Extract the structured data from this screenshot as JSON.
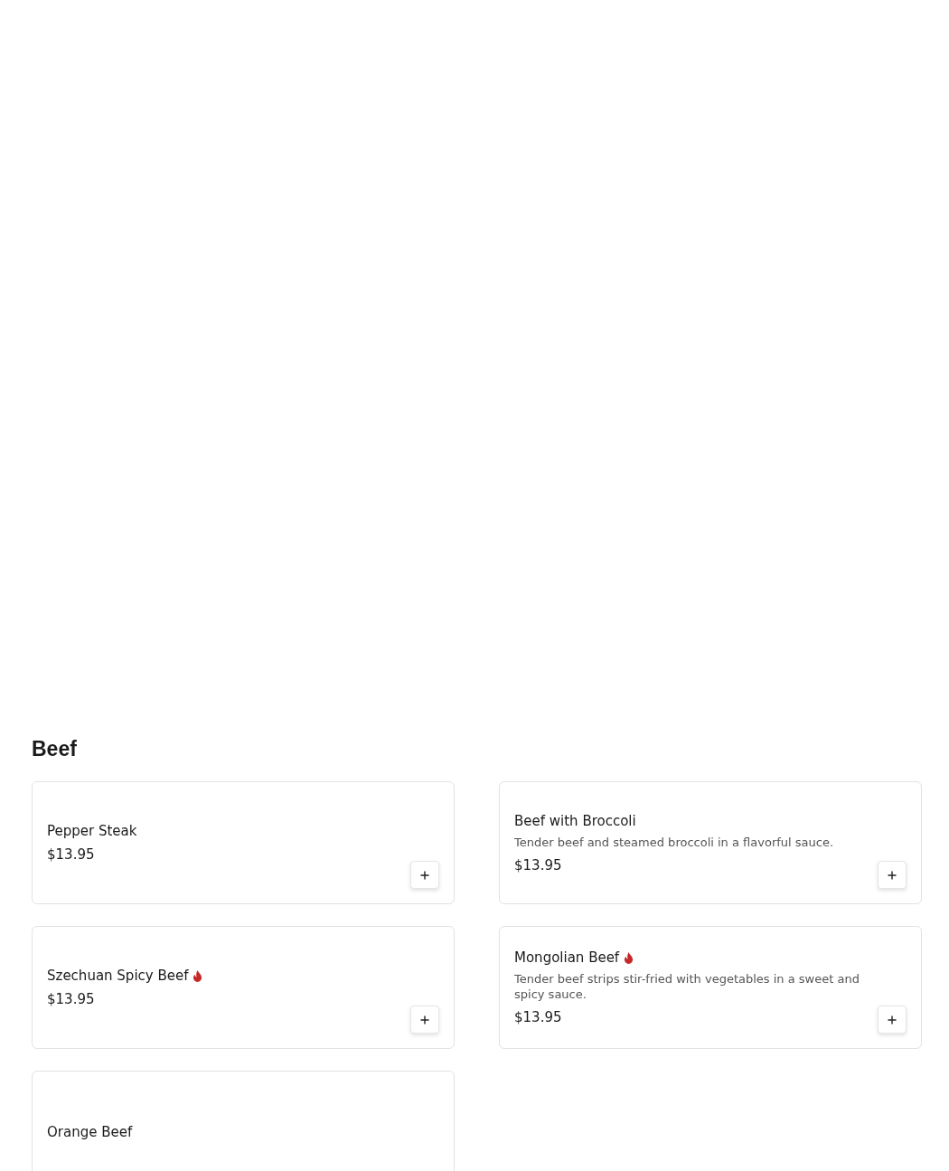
{
  "section": {
    "title": "Beef",
    "items": [
      {
        "name": "Pepper Steak",
        "spicy": false,
        "price": "$13.95"
      },
      {
        "name": "Beef with Broccoli",
        "spicy": false,
        "description": "Tender beef and steamed broccoli in a flavorful sauce.",
        "price": "$13.95"
      },
      {
        "name": "Szechuan Spicy Beef",
        "spicy": true,
        "price": "$13.95"
      },
      {
        "name": "Mongolian Beef",
        "spicy": true,
        "description": "Tender beef strips stir-fried with vegetables in a sweet and spicy sauce.",
        "price": "$13.95"
      },
      {
        "name": "Orange Beef",
        "spicy": false
      }
    ]
  }
}
